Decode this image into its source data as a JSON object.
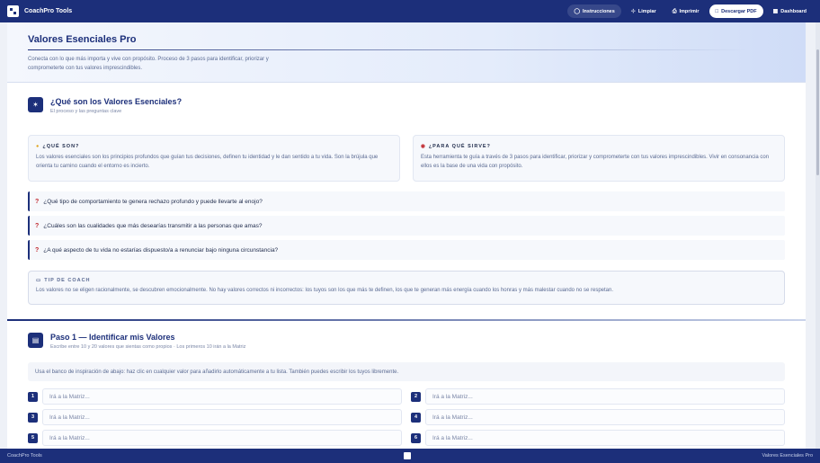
{
  "app": {
    "brand": "CoachPro Tools"
  },
  "nav": {
    "instrucciones": "Instrucciones",
    "limpiar": "Limpiar",
    "imprimir": "Imprimir",
    "descargar": "Descargar PDF",
    "dashboard": "Dashboard"
  },
  "hero": {
    "title": "Valores Esenciales Pro",
    "description": "Conecta con lo que más importa y vive con propósito. Proceso de 3 pasos para identificar, priorizar y comprometerte con tus valores imprescindibles."
  },
  "intro": {
    "title": "¿Qué son los Valores Esenciales?",
    "subtitle": "El proceso y las preguntas clave",
    "que_son": {
      "label": "¿QUÉ SON?",
      "text": "Los valores esenciales son los principios profundos que guían tus decisiones, definen tu identidad y le dan sentido a tu vida. Son la brújula que orienta tu camino cuando el entorno es incierto."
    },
    "para_que": {
      "label": "¿PARA QUÉ SIRVE?",
      "text": "Esta herramienta te guía a través de 3 pasos para identificar, priorizar y comprometerte con tus valores imprescindibles. Vivir en consonancia con ellos es la base de una vida con propósito."
    },
    "questions": [
      "¿Qué tipo de comportamiento te genera rechazo profundo y puede llevarte al enojo?",
      "¿Cuáles son las cualidades que más desearías transmitir a las personas que amas?",
      "¿A qué aspecto de tu vida no estarías dispuesto/a a renunciar bajo ninguna circunstancia?"
    ],
    "tip": {
      "label": "TIP DE COACH",
      "text": "Los valores no se eligen racionalmente, se descubren emocionalmente. No hay valores correctos ni incorrectos: los tuyos son los que más te definen, los que te generan más energía cuando los honras y más malestar cuando no se respetan."
    }
  },
  "paso1": {
    "title": "Paso 1 — Identificar mis Valores",
    "subtitle": "Escribe entre 10 y 20 valores que sientas como propios · Los primeros 10 irán a la Matriz",
    "hint": "Usa el banco de inspiración de abajo: haz clic en cualquier valor para añadirlo automáticamente a tu lista. También puedes escribir los tuyos libremente.",
    "placeholder": "Irá a la Matriz...",
    "numbers": [
      "1",
      "2",
      "3",
      "4",
      "5",
      "6"
    ]
  },
  "footer": {
    "left": "CoachPro Tools",
    "right": "Valores Esenciales Pro"
  },
  "colors": {
    "primary": "#1c2f7a",
    "accent_red": "#c0282e"
  }
}
